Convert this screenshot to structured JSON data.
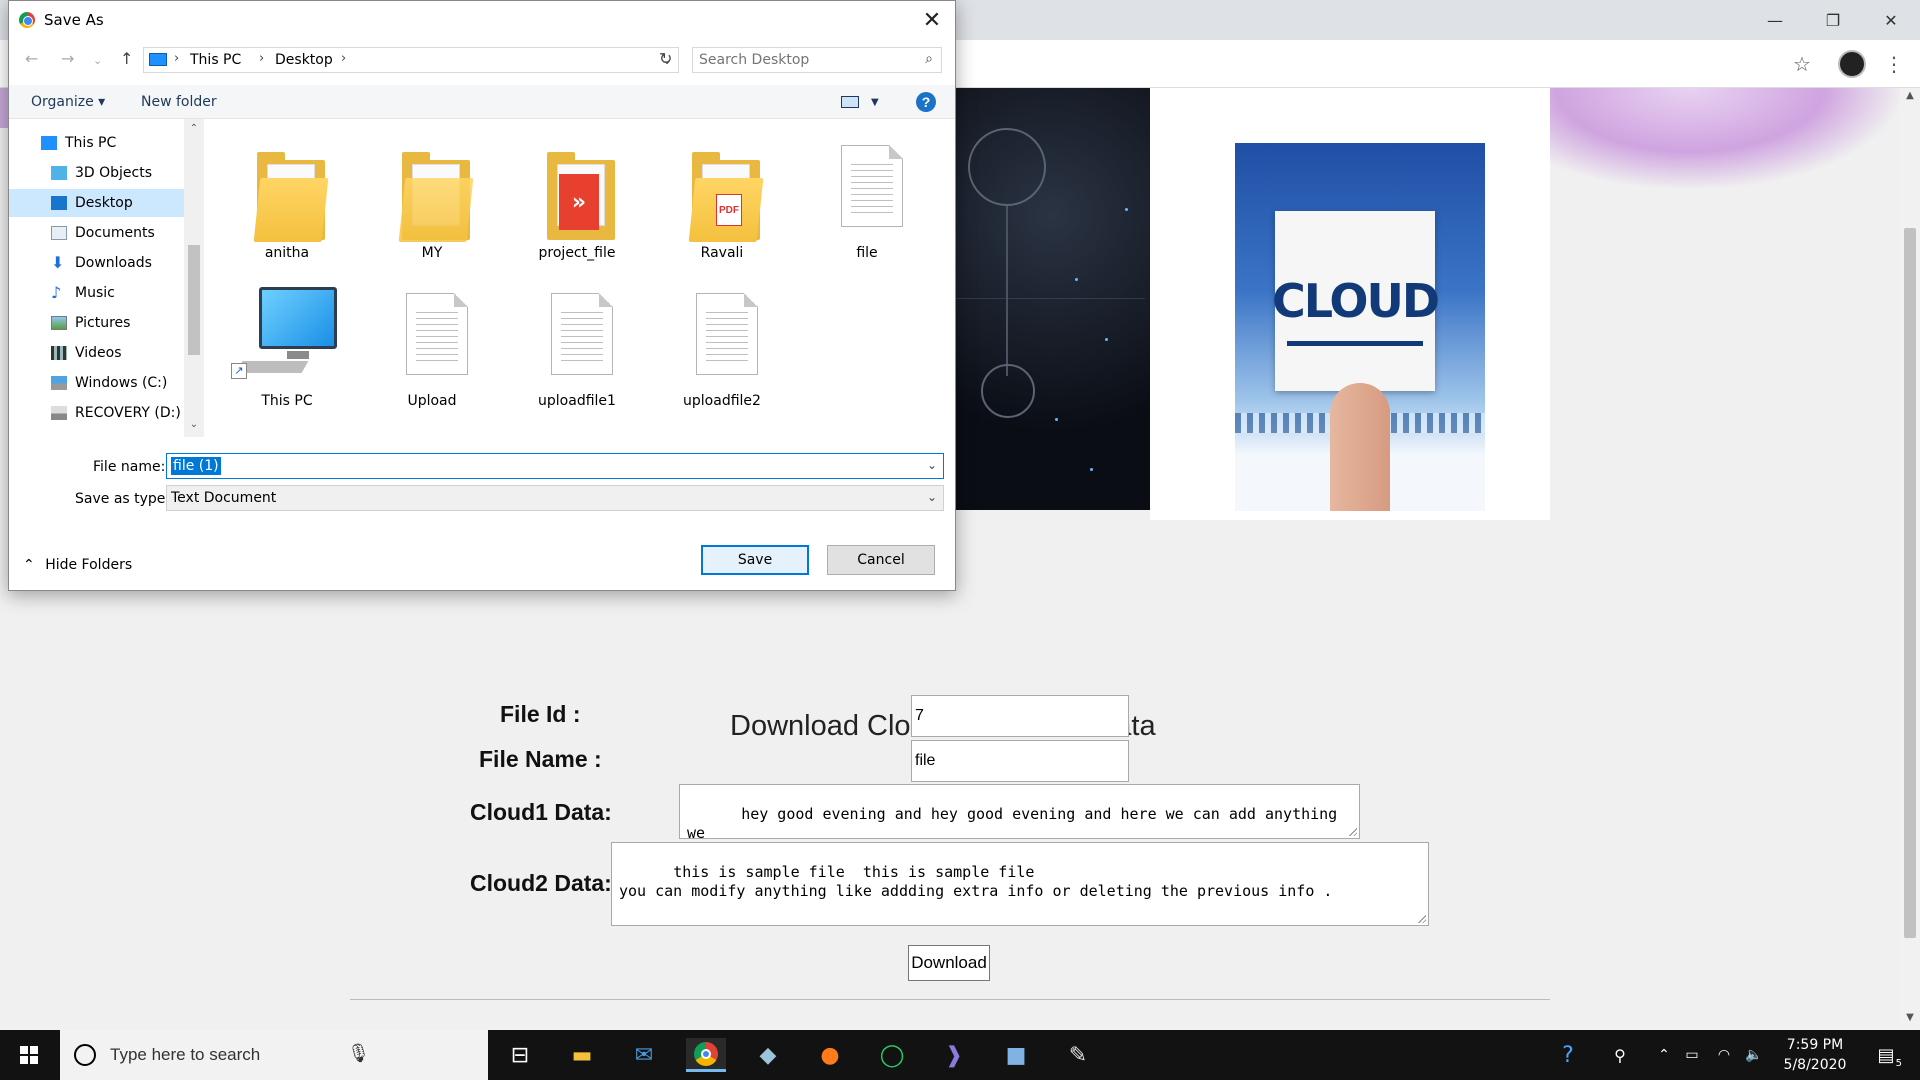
{
  "browser": {
    "window_controls": {
      "minimize": "—",
      "restore": "❐",
      "close": "✕"
    },
    "toolbar": {
      "star_icon": "☆",
      "menu_icon": "⋮"
    }
  },
  "page": {
    "heading": "Download Cloud1 & Cloud2 Data",
    "hero_image_text": "CLOUD",
    "form": {
      "file_id_label": "File Id :",
      "file_id_value": "7",
      "file_name_label": "File Name :",
      "file_name_value": "file",
      "cloud1_label": "Cloud1 Data:",
      "cloud1_value": "hey good evening and hey good evening and here we can add anything we\nwant and we can modify the file.",
      "cloud2_label": "Cloud2 Data:",
      "cloud2_value": "this is sample file  this is sample file\nyou can modify anything like addding extra info or deleting the previous info .",
      "download_label": "Download"
    }
  },
  "dialog": {
    "title": "Save As",
    "close_icon": "✕",
    "breadcrumb": [
      "This PC",
      "Desktop"
    ],
    "search_placeholder": "Search Desktop",
    "toolbar": {
      "organize": "Organize ▾",
      "new_folder": "New folder",
      "help": "?"
    },
    "nav_items": [
      {
        "label": "This PC",
        "icon": "computer-icon"
      },
      {
        "label": "3D Objects",
        "icon": "cube-icon"
      },
      {
        "label": "Desktop",
        "icon": "desktop-icon",
        "selected": true
      },
      {
        "label": "Documents",
        "icon": "document-icon"
      },
      {
        "label": "Downloads",
        "icon": "download-icon"
      },
      {
        "label": "Music",
        "icon": "music-icon"
      },
      {
        "label": "Pictures",
        "icon": "pictures-icon"
      },
      {
        "label": "Videos",
        "icon": "video-icon"
      },
      {
        "label": "Windows (C:)",
        "icon": "drive-icon"
      },
      {
        "label": "RECOVERY (D:)",
        "icon": "drive-icon"
      }
    ],
    "files": [
      {
        "name": "anitha",
        "type": "folder"
      },
      {
        "name": "MY",
        "type": "folder"
      },
      {
        "name": "project_file",
        "type": "folder-red"
      },
      {
        "name": "Ravali",
        "type": "folder-pdf"
      },
      {
        "name": "file",
        "type": "document"
      },
      {
        "name": "This PC",
        "type": "computer"
      },
      {
        "name": "Upload",
        "type": "document"
      },
      {
        "name": "uploadfile1",
        "type": "document"
      },
      {
        "name": "uploadfile2",
        "type": "document"
      }
    ],
    "file_name_label": "File name:",
    "file_name_value": "file (1)",
    "save_type_label": "Save as type:",
    "save_type_value": "Text Document",
    "save_label": "Save",
    "cancel_label": "Cancel",
    "hide_folders_label": "Hide Folders"
  },
  "taskbar": {
    "search_placeholder": "Type here to search",
    "time": "7:59 PM",
    "date": "5/8/2020",
    "notification_count": "5"
  }
}
